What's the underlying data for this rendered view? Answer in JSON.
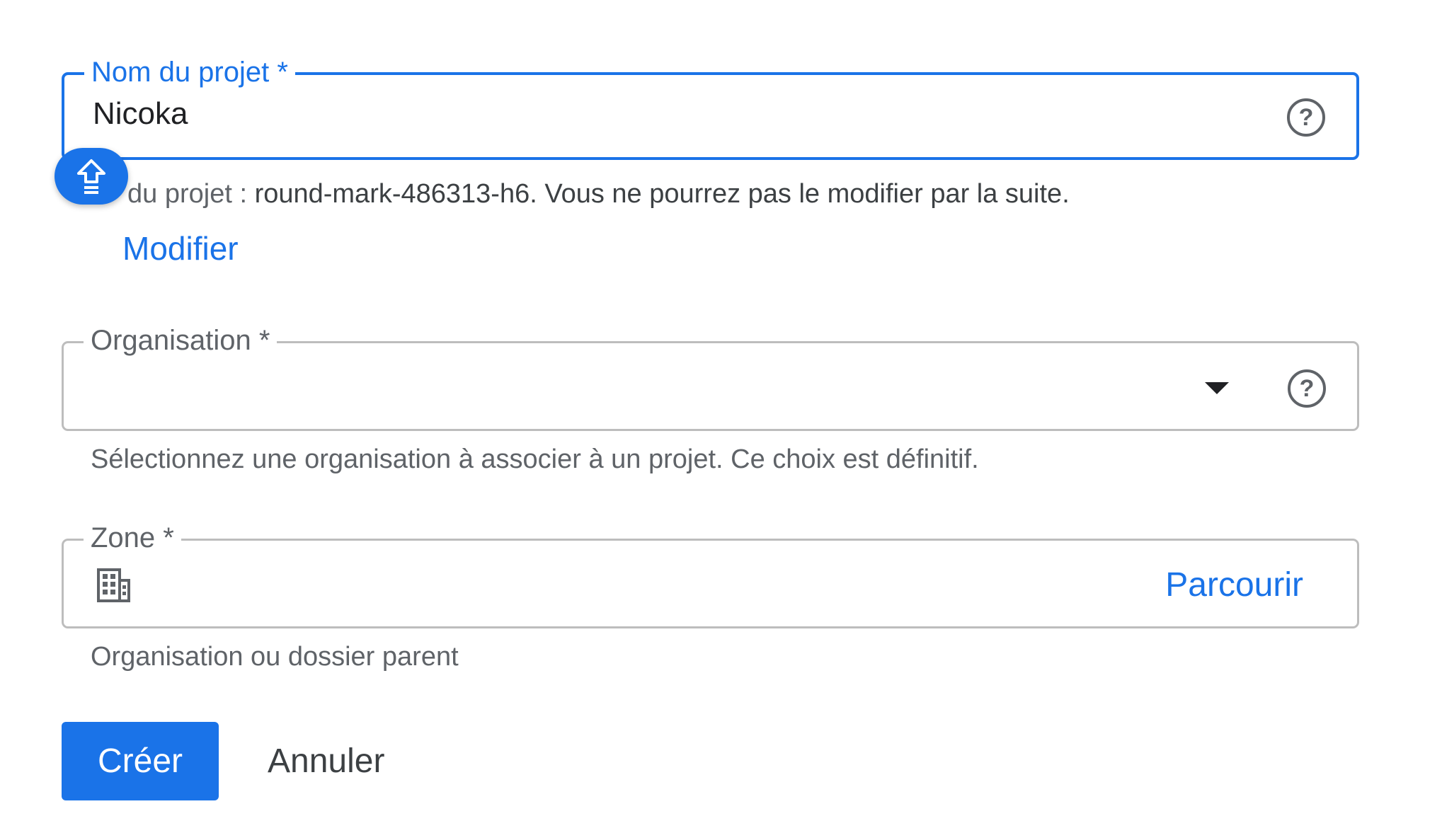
{
  "project_name": {
    "label": "Nom du projet *",
    "value": "Nicoka",
    "help_icon": "help-circle-icon"
  },
  "badge": {
    "icon": "upload-arrow-icon",
    "color": "#1a73e8"
  },
  "project_id": {
    "prefix": "du projet : ",
    "id_text": "round-mark-486313-h6. Vous ne pourrez pas le modifier par la suite.",
    "modify_label": "Modifier"
  },
  "organisation": {
    "label": "Organisation *",
    "value": "",
    "dropdown_icon": "dropdown-arrow-icon",
    "help_icon": "help-circle-icon",
    "helper": "Sélectionnez une organisation à associer à un projet. Ce choix est définitif."
  },
  "zone": {
    "label": "Zone *",
    "icon": "building-icon",
    "browse_label": "Parcourir",
    "helper": "Organisation ou dossier parent"
  },
  "actions": {
    "create_label": "Créer",
    "cancel_label": "Annuler"
  },
  "colors": {
    "accent": "#1a73e8",
    "text": "#202124",
    "muted": "#5f6368",
    "border": "#bdbdbd"
  }
}
